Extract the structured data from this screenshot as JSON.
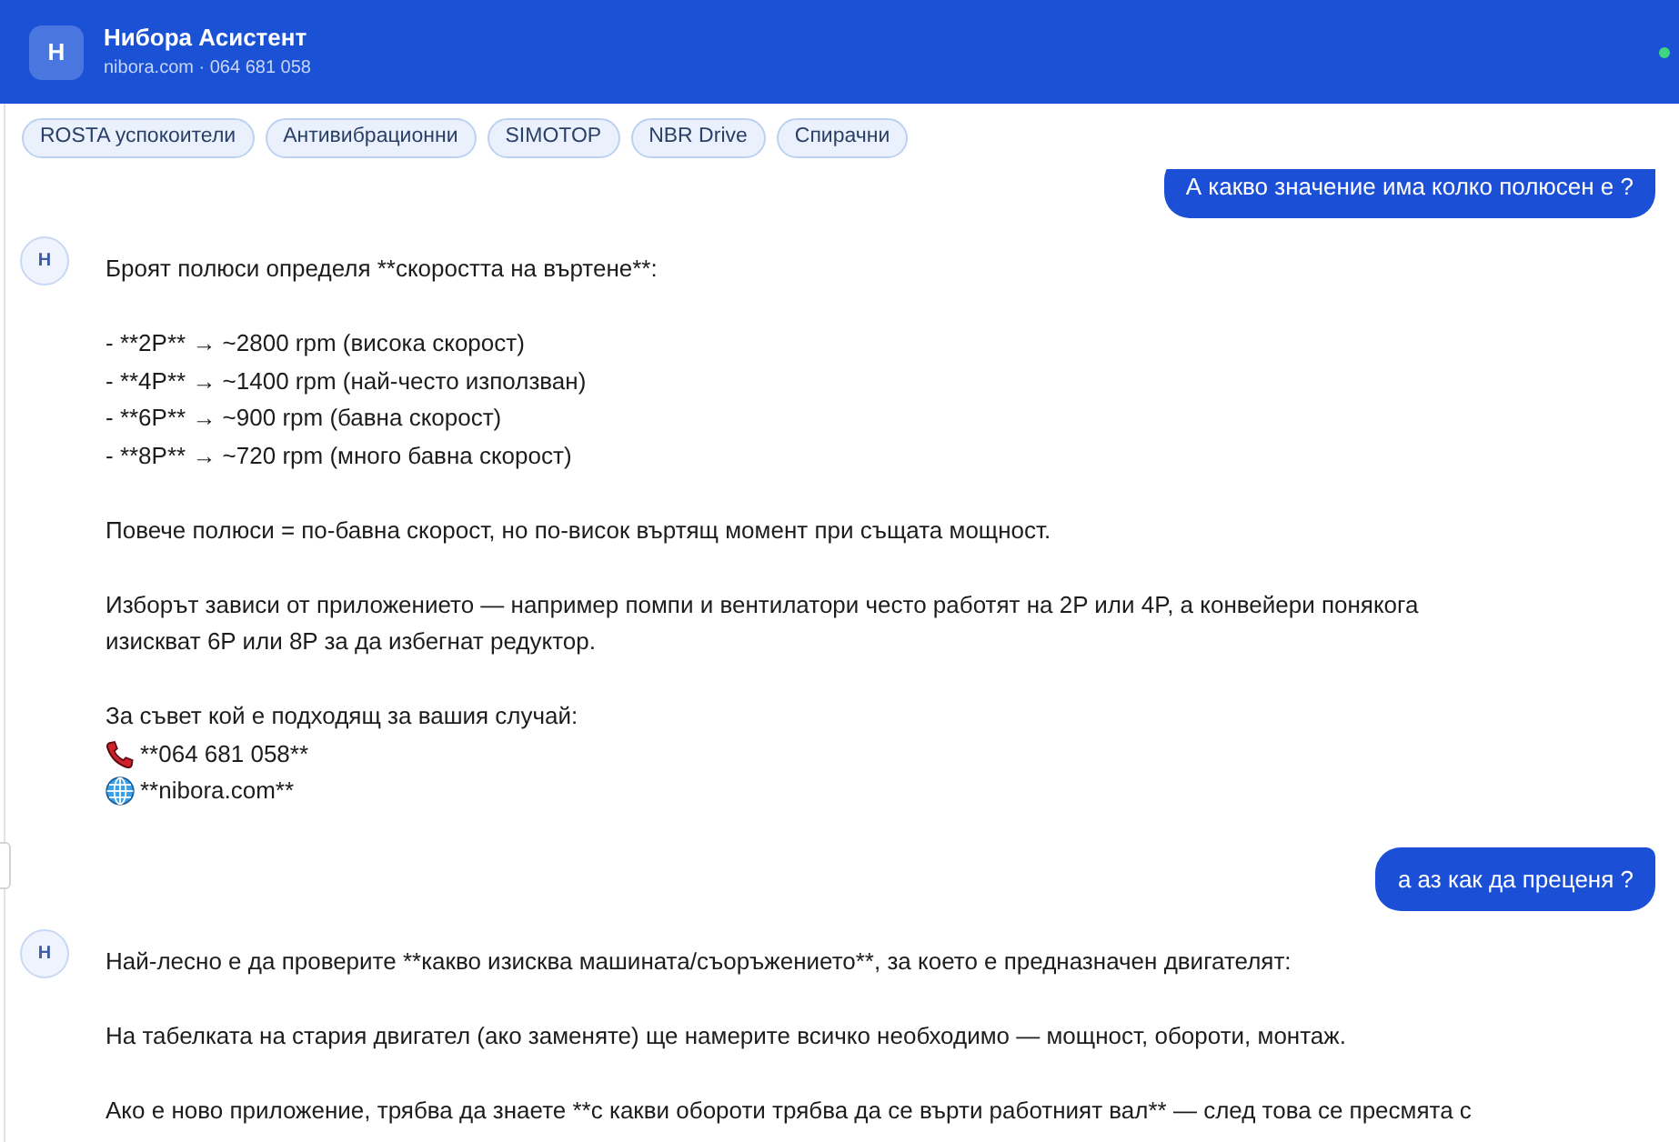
{
  "header": {
    "avatar_letter": "Н",
    "title": "Нибора Асистент",
    "subtitle": "nibora.com · 064 681 058",
    "online": true
  },
  "chips": [
    "ROSTA успокоители",
    "Антивибрационни",
    "SIMOTOP",
    "NBR Drive",
    "Спирачни"
  ],
  "messages": [
    {
      "kind": "user",
      "text": "А какво значение има колко полюсен е ?"
    },
    {
      "kind": "assistant",
      "avatar_letter": "Н",
      "blocks": [
        {
          "kind": "paragraph",
          "lines": [
            "Броят полюси определя **скоростта на въртене**:"
          ]
        },
        {
          "kind": "list",
          "items": [
            "- **2P** → ~2800 rpm (висока скорост)",
            "- **4P** → ~1400 rpm (най-често използван)",
            "- **6P** → ~900 rpm (бавна скорост)",
            "- **8P** → ~720 rpm (много бавна скорост)"
          ]
        },
        {
          "kind": "paragraph",
          "lines": [
            "Повече полюси = по-бавна скорост, но по-висок въртящ момент при същата мощност."
          ]
        },
        {
          "kind": "paragraph",
          "lines": [
            "Изборът зависи от приложението — например помпи и вентилатори често работят на 2P или 4P, а конвейери понякога",
            "изискват 6P или 8P за да избегнат редуктор."
          ]
        },
        {
          "kind": "contacts",
          "intro": "За съвет кой е подходящ за вашия случай:",
          "items": [
            {
              "kind": "phone",
              "text": "**064 681 058**"
            },
            {
              "kind": "web",
              "text": "**nibora.com**"
            }
          ]
        }
      ]
    },
    {
      "kind": "user",
      "text": "а аз как да преценя ?"
    },
    {
      "kind": "assistant",
      "avatar_letter": "Н",
      "blocks": [
        {
          "kind": "paragraph",
          "lines": [
            "Най-лесно е да проверите **какво изисква машината/съоръжението**, за което е предназначен двигателят:"
          ]
        },
        {
          "kind": "paragraph",
          "lines": [
            "На табелката на стария двигател (ако заменяте) ще намерите всичко необходимо — мощност, обороти, монтаж."
          ]
        },
        {
          "kind": "paragraph",
          "lines": [
            "Ако е ново приложение, трябва да знаете **с какви обороти трябва да се върти работният вал** — след това се пресмята с"
          ]
        }
      ]
    }
  ]
}
